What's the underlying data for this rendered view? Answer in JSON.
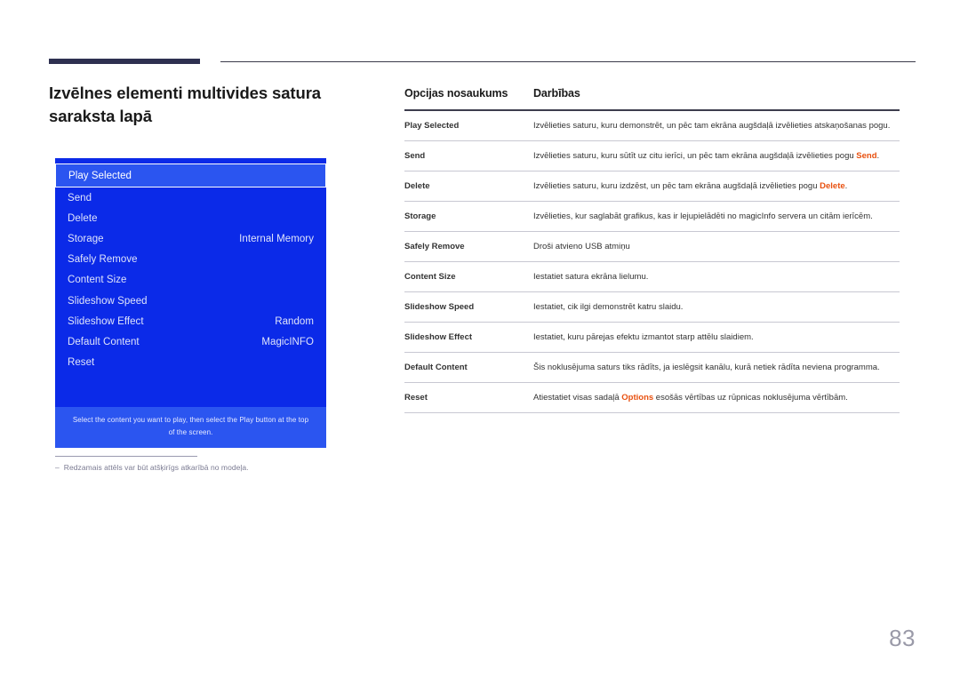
{
  "page": {
    "title": "Izvēlnes elementi multivides satura saraksta lapā",
    "number": "83"
  },
  "osd": {
    "items": [
      {
        "label": "Play Selected",
        "value": "",
        "selected": true
      },
      {
        "label": "Send",
        "value": "",
        "selected": false
      },
      {
        "label": "Delete",
        "value": "",
        "selected": false
      },
      {
        "label": "Storage",
        "value": "Internal Memory",
        "selected": false
      },
      {
        "label": "Safely Remove",
        "value": "",
        "selected": false
      },
      {
        "label": "Content Size",
        "value": "",
        "selected": false
      },
      {
        "label": "Slideshow Speed",
        "value": "",
        "selected": false
      },
      {
        "label": "Slideshow Effect",
        "value": "Random",
        "selected": false
      },
      {
        "label": "Default Content",
        "value": "MagicINFO",
        "selected": false
      },
      {
        "label": "Reset",
        "value": "",
        "selected": false
      }
    ],
    "hint": "Select the content you want to play, then select the Play button at the top of the screen."
  },
  "footnote": {
    "dash": "‒",
    "text": "Redzamais attēls var būt atšķirīgs atkarībā no modeļa."
  },
  "table": {
    "headers": [
      "Opcijas nosaukums",
      "Darbības"
    ],
    "rows": [
      {
        "option": "Play Selected",
        "desc_parts": [
          {
            "t": "Izvēlieties saturu, kuru demonstrēt, un pēc tam ekrāna augšdaļā izvēlieties atskaņošanas pogu.",
            "hl": false
          }
        ]
      },
      {
        "option": "Send",
        "desc_parts": [
          {
            "t": "Izvēlieties saturu, kuru sūtīt uz citu ierīci, un pēc tam ekrāna augšdaļā izvēlieties pogu ",
            "hl": false
          },
          {
            "t": "Send",
            "hl": true
          },
          {
            "t": ".",
            "hl": false
          }
        ]
      },
      {
        "option": "Delete",
        "desc_parts": [
          {
            "t": "Izvēlieties saturu, kuru izdzēst, un pēc tam ekrāna augšdaļā izvēlieties pogu ",
            "hl": false
          },
          {
            "t": "Delete",
            "hl": true
          },
          {
            "t": ".",
            "hl": false
          }
        ]
      },
      {
        "option": "Storage",
        "desc_parts": [
          {
            "t": "Izvēlieties, kur saglabāt grafikus, kas ir lejupielādēti no magicInfo servera un citām ierīcēm.",
            "hl": false
          }
        ]
      },
      {
        "option": "Safely Remove",
        "desc_parts": [
          {
            "t": "Droši atvieno USB atmiņu",
            "hl": false
          }
        ]
      },
      {
        "option": "Content Size",
        "desc_parts": [
          {
            "t": "Iestatiet satura ekrāna lielumu.",
            "hl": false
          }
        ]
      },
      {
        "option": "Slideshow Speed",
        "desc_parts": [
          {
            "t": "Iestatiet, cik ilgi demonstrēt katru slaidu.",
            "hl": false
          }
        ]
      },
      {
        "option": "Slideshow Effect",
        "desc_parts": [
          {
            "t": "Iestatiet, kuru pārejas efektu izmantot starp attēlu slaidiem.",
            "hl": false
          }
        ]
      },
      {
        "option": "Default Content",
        "desc_parts": [
          {
            "t": "Šis noklusējuma saturs tiks rādīts, ja ieslēgsit kanālu, kurā netiek rādīta neviena programma.",
            "hl": false
          }
        ]
      },
      {
        "option": "Reset",
        "desc_parts": [
          {
            "t": "Atiestatiet visas sadaļā ",
            "hl": false
          },
          {
            "t": "Options",
            "hl": true
          },
          {
            "t": " esošās vērtības uz rūpnicas noklusējuma vērtībām.",
            "hl": false
          }
        ]
      }
    ]
  },
  "colors": {
    "accent_orange": "#e8500f",
    "osd_blue": "#0b2ae8",
    "osd_blue_light": "#2b55f0",
    "rule_navy": "#2e3050"
  }
}
